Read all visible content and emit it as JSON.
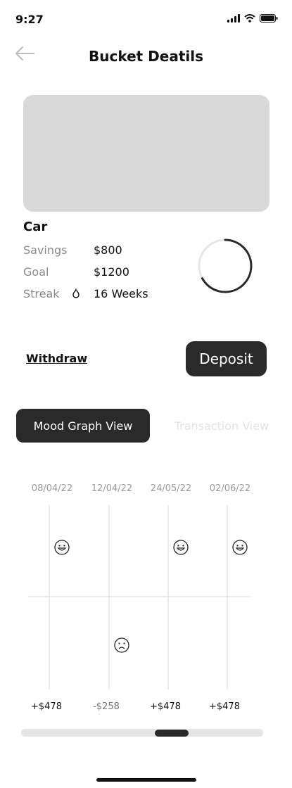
{
  "status": {
    "time": "9:27"
  },
  "header": {
    "title": "Bucket Deatils"
  },
  "bucket": {
    "name": "Car",
    "rows": [
      {
        "label": "Savings",
        "value": "$800"
      },
      {
        "label": "Goal",
        "value": "$1200"
      },
      {
        "label": "Streak",
        "value": "16 Weeks",
        "icon": "flame-icon"
      }
    ],
    "progress_fraction": 0.67
  },
  "actions": {
    "withdraw": "Withdraw",
    "deposit": "Deposit"
  },
  "tabs": {
    "active": "Mood Graph View",
    "inactive": "Transaction View"
  },
  "mood_graph": {
    "entries": [
      {
        "date": "08/04/22",
        "mood": "happy",
        "amount": "+$478"
      },
      {
        "date": "12/04/22",
        "mood": "sad",
        "amount": "-$258"
      },
      {
        "date": "24/05/22",
        "mood": "happy",
        "amount": "+$478"
      },
      {
        "date": "02/06/22",
        "mood": "happy",
        "amount": "+$478"
      }
    ]
  },
  "colors": {
    "primary": "#2a2a2a",
    "grid": "#e6e6e6",
    "muted": "#8a8a8a"
  }
}
